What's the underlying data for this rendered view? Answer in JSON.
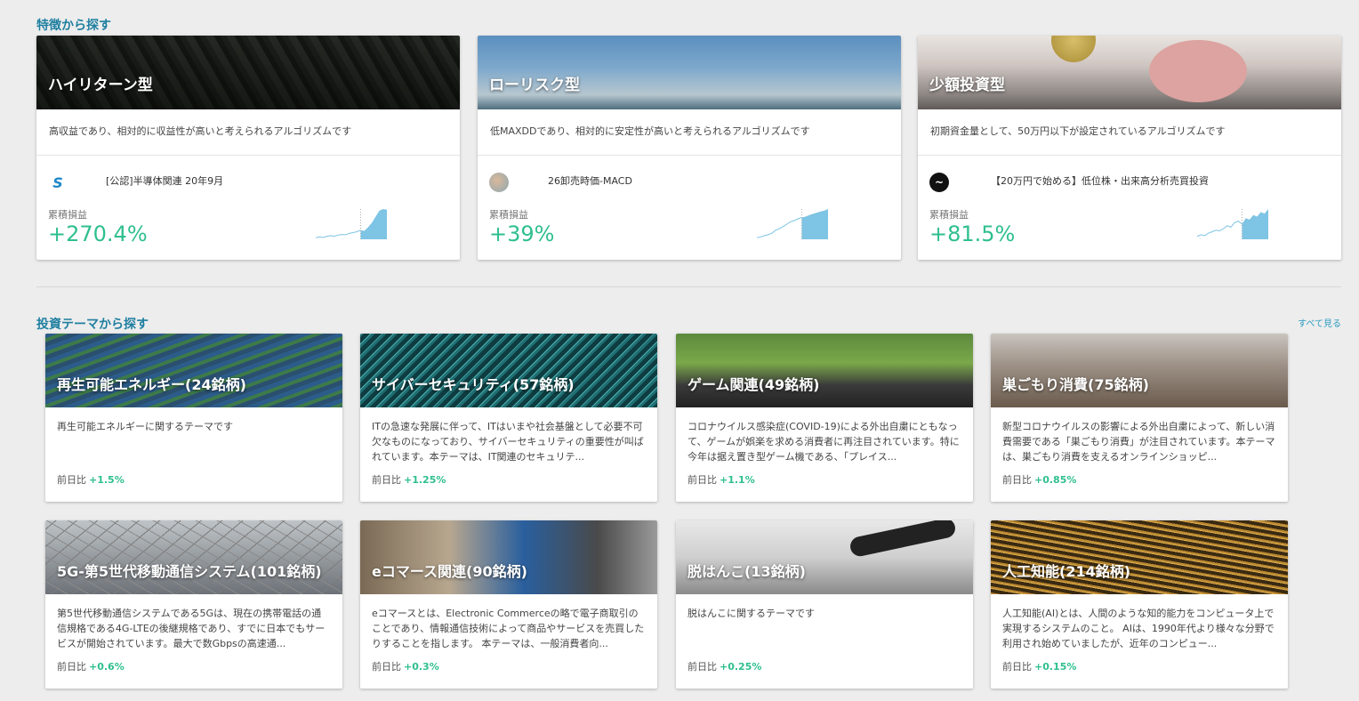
{
  "section1": {
    "title": "特徴から探す"
  },
  "features": [
    {
      "title": "ハイリターン型",
      "desc": "高収益であり、相対的に収益性が高いと考えられるアルゴリズムです",
      "algo_name": "[公認]半導体関連 20年9月",
      "profit_label": "累積損益",
      "profit": "+270.4%",
      "avatar": "s-logo-icon",
      "spark": [
        0.05,
        0.08,
        0.06,
        0.1,
        0.12,
        0.1,
        0.14,
        0.16,
        0.15,
        0.2,
        0.22,
        0.25,
        0.3,
        0.28,
        0.4,
        0.55,
        0.75,
        0.95,
        1.0,
        0.98
      ]
    },
    {
      "title": "ローリスク型",
      "desc": "低MAXDDであり、相対的に安定性が高いと考えられるアルゴリズムです",
      "algo_name": "26卸売時価-MACD",
      "profit_label": "累積損益",
      "profit": "+39%",
      "avatar": "user-avatar-icon",
      "spark": [
        0.05,
        0.08,
        0.12,
        0.15,
        0.2,
        0.3,
        0.35,
        0.42,
        0.5,
        0.58,
        0.62,
        0.68,
        0.72,
        0.75,
        0.8,
        0.84,
        0.88,
        0.92,
        0.95,
        1.0
      ]
    },
    {
      "title": "少額投資型",
      "desc": "初期資金量として、50万円以下が設定されているアルゴリズムです",
      "algo_name": "【20万円で始める】低位株・出来高分析売買投資",
      "profit_label": "累積損益",
      "profit": "+81.5%",
      "avatar": "wave-logo-icon",
      "spark": [
        0.1,
        0.15,
        0.12,
        0.2,
        0.25,
        0.3,
        0.28,
        0.35,
        0.45,
        0.4,
        0.55,
        0.6,
        0.5,
        0.7,
        0.65,
        0.8,
        0.75,
        0.9,
        0.85,
        1.0
      ]
    }
  ],
  "section2": {
    "title": "投資テーマから探す",
    "see_all": "すべて見る"
  },
  "themes": [
    {
      "title": "再生可能エネルギー(24銘柄)",
      "desc": "再生可能エネルギーに関するテーマです",
      "change_label": "前日比",
      "change": "+1.5%"
    },
    {
      "title": "サイバーセキュリティ(57銘柄)",
      "desc": "ITの急速な発展に伴って、ITはいまや社会基盤として必要不可欠なものになっており、サイバーセキュリティの重要性が叫ばれています。本テーマは、IT関連のセキュリテ...",
      "change_label": "前日比",
      "change": "+1.25%"
    },
    {
      "title": "ゲーム関連(49銘柄)",
      "desc": "コロナウイルス感染症(COVID-19)による外出自粛にともなって、ゲームが娯楽を求める消費者に再注目されています。特に今年は据え置き型ゲーム機である、「プレイス...",
      "change_label": "前日比",
      "change": "+1.1%"
    },
    {
      "title": "巣ごもり消費(75銘柄)",
      "desc": "新型コロナウイルスの影響による外出自粛によって、新しい消費需要である「巣ごもり消費」が注目されています。本テーマは、巣ごもり消費を支えるオンラインショッピ...",
      "change_label": "前日比",
      "change": "+0.85%"
    },
    {
      "title": "5G-第5世代移動通信システム(101銘柄)",
      "desc": "第5世代移動通信システムである5Gは、現在の携帯電話の通信規格である4G-LTEの後継規格であり、すでに日本でもサービスが開始されています。最大で数Gbpsの高速通...",
      "change_label": "前日比",
      "change": "+0.6%"
    },
    {
      "title": "eコマース関連(90銘柄)",
      "desc": "eコマースとは、Electronic Commerceの略で電子商取引のことであり、情報通信技術によって商品やサービスを売買したりすることを指します。 本テーマは、一般消費者向...",
      "change_label": "前日比",
      "change": "+0.3%"
    },
    {
      "title": "脱はんこ(13銘柄)",
      "desc": "脱はんこに関するテーマです",
      "change_label": "前日比",
      "change": "+0.25%"
    },
    {
      "title": "人工知能(214銘柄)",
      "desc": "人工知能(AI)とは、人間のような知的能力をコンピュータ上で実現するシステムのこと。 AIは、1990年代より様々な分野で利用され始めていましたが、近年のコンピュー...",
      "change_label": "前日比",
      "change": "+0.15%"
    }
  ],
  "colors": {
    "accent": "#1f7fa0",
    "positive": "#2fbf8f",
    "spark": "#7ec4e4"
  }
}
